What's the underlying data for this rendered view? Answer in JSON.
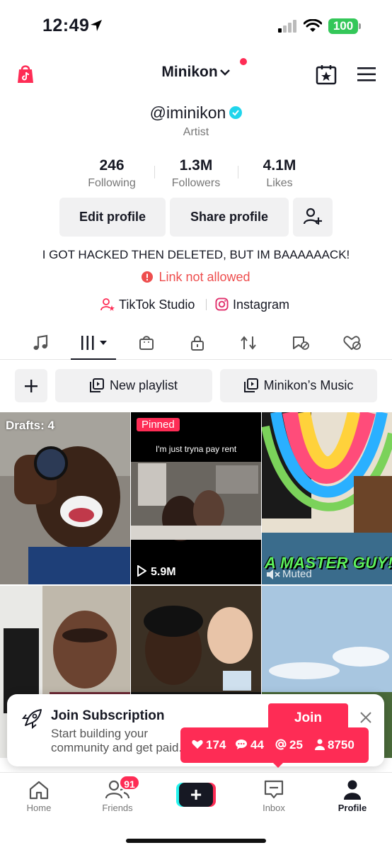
{
  "status_bar": {
    "time": "12:49",
    "battery": "100"
  },
  "header": {
    "username": "Minikon"
  },
  "profile": {
    "handle": "@iminikon",
    "role": "Artist",
    "stats": [
      {
        "value": "246",
        "label": "Following"
      },
      {
        "value": "1.3M",
        "label": "Followers"
      },
      {
        "value": "4.1M",
        "label": "Likes"
      }
    ],
    "buttons": {
      "edit": "Edit profile",
      "share": "Share profile"
    },
    "bio": "I GOT HACKED THEN DELETED, BUT IM BAAAAAACK!",
    "warning": "Link not allowed",
    "links": {
      "studio": "TikTok Studio",
      "instagram": "Instagram"
    }
  },
  "playlists": {
    "new": "New playlist",
    "music": "Minikon’s Music"
  },
  "grid": {
    "drafts": "Drafts: 4",
    "pinned": "Pinned",
    "caption": "I'm just tryna pay rent",
    "views": "5.9M",
    "overlay_text": "A MASTER GUY!",
    "muted": "Muted"
  },
  "promo": {
    "title": "Join Subscription",
    "desc": "Start building your community and get paid.",
    "join": "Join"
  },
  "notifications": {
    "likes": "174",
    "comments": "44",
    "mentions": "25",
    "followers": "8750"
  },
  "bottom_nav": {
    "home": "Home",
    "friends": "Friends",
    "friends_badge": "91",
    "inbox": "Inbox",
    "profile": "Profile"
  },
  "colors": {
    "accent": "#fe2c55",
    "cyan": "#25f4ee",
    "battery": "#34c759"
  }
}
